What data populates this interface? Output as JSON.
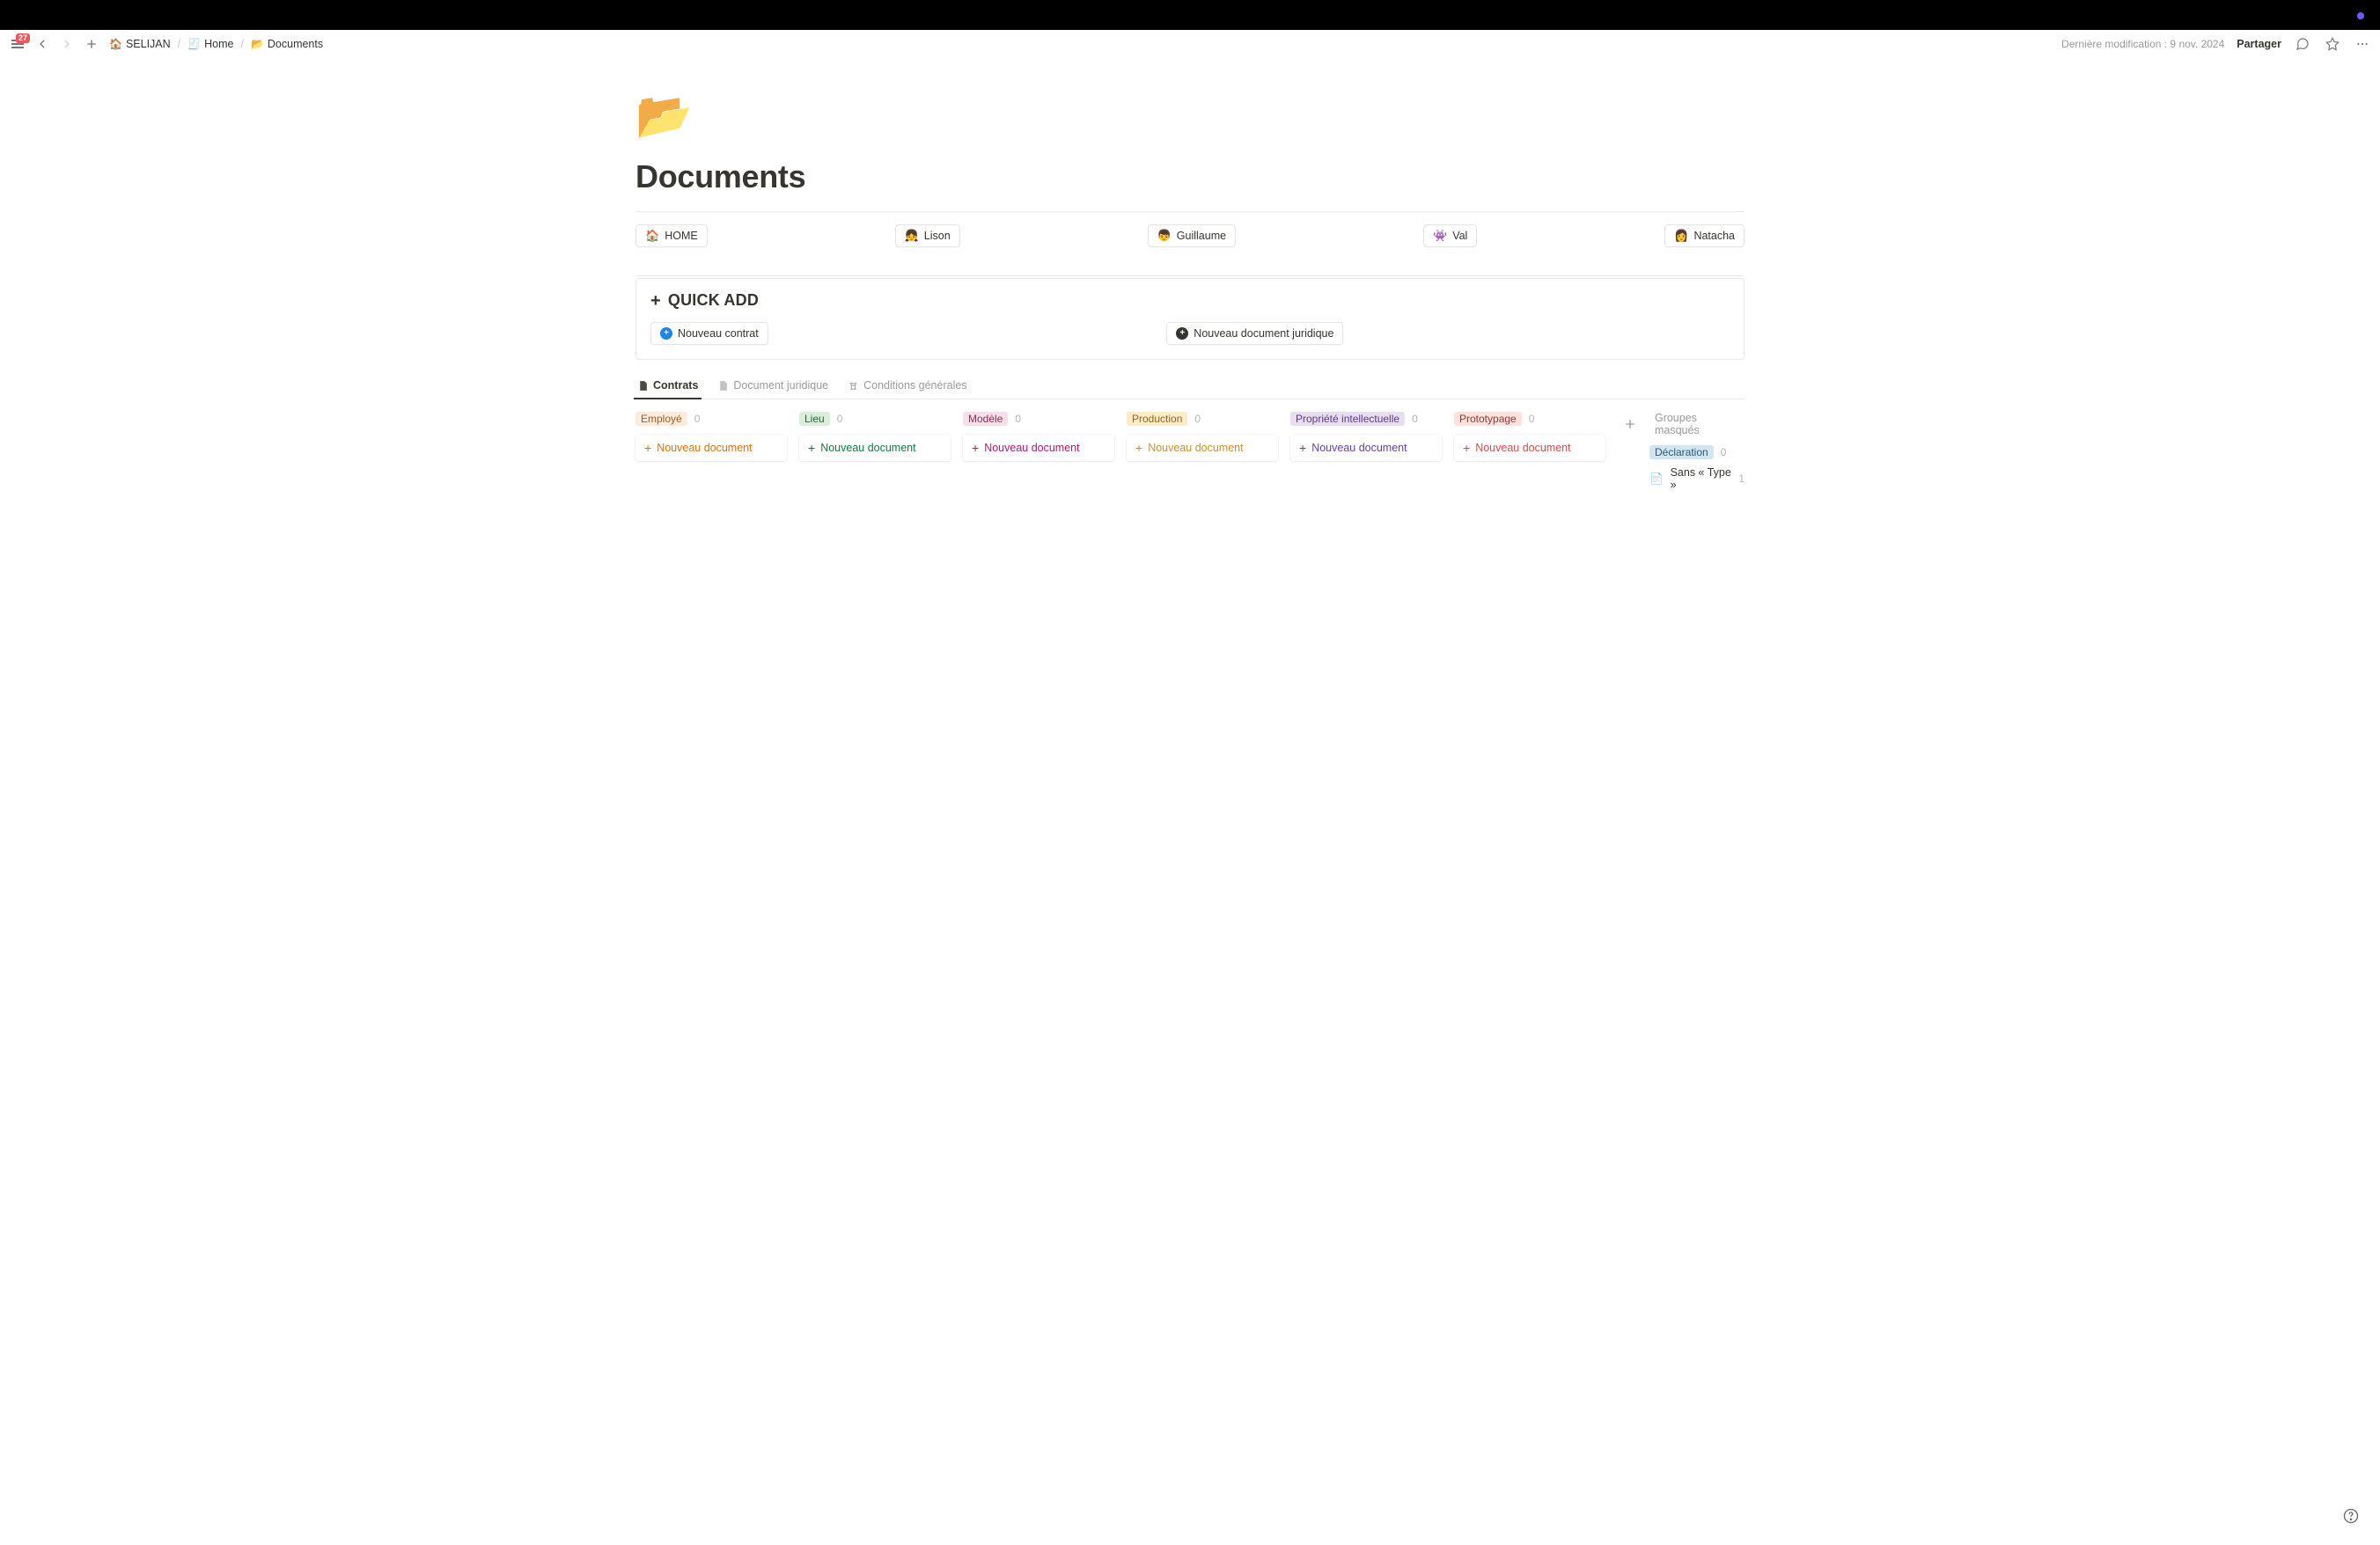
{
  "topbar": {
    "badge_count": "27",
    "breadcrumb": [
      {
        "icon": "🏠",
        "label": "SELIJAN"
      },
      {
        "icon": "🧾",
        "label": "Home"
      },
      {
        "icon": "📂",
        "label": "Documents"
      }
    ],
    "last_modified": "Dernière modification : 9 nov. 2024",
    "share_label": "Partager"
  },
  "page": {
    "icon": "📂",
    "title": "Documents"
  },
  "people": [
    {
      "icon": "🏠",
      "label": "HOME"
    },
    {
      "icon": "👧",
      "label": "Lison"
    },
    {
      "icon": "👦",
      "label": "Guillaume"
    },
    {
      "icon": "👾",
      "label": "Val"
    },
    {
      "icon": "👩",
      "label": "Natacha"
    }
  ],
  "quickadd": {
    "title": "QUICK ADD",
    "btn1": "Nouveau contrat",
    "btn2": "Nouveau document juridique"
  },
  "tabs": [
    {
      "label": "Contrats",
      "active": true
    },
    {
      "label": "Document juridique",
      "active": false
    },
    {
      "label": "Conditions générales",
      "active": false
    }
  ],
  "board": {
    "new_doc_label": "Nouveau document",
    "columns": [
      {
        "tag": "Employé",
        "count": 0,
        "bg": "#fdecdd",
        "fg": "#a05b1f",
        "plus": "#d9730d"
      },
      {
        "tag": "Lieu",
        "count": 0,
        "bg": "#dbeddb",
        "fg": "#1c6b3c",
        "plus": "#0f7b3f"
      },
      {
        "tag": "Modèle",
        "count": 0,
        "bg": "#f5e0e9",
        "fg": "#8a2e5b",
        "plus": "#ad1a72"
      },
      {
        "tag": "Production",
        "count": 0,
        "bg": "#fdecc8",
        "fg": "#8a6a1f",
        "plus": "#cb912f"
      },
      {
        "tag": "Propriété intellectuelle",
        "count": 0,
        "bg": "#e8deee",
        "fg": "#5b3a86",
        "plus": "#6940a5"
      },
      {
        "tag": "Prototypage",
        "count": 0,
        "bg": "#ffe2dd",
        "fg": "#8a3a34",
        "plus": "#d44c47"
      }
    ],
    "hidden_groups_label": "Groupes masqués",
    "hidden": [
      {
        "tag": "Déclaration",
        "count": 0,
        "bg": "#d3e5ef",
        "fg": "#2a5a7a"
      },
      {
        "icon": "📄",
        "label": "Sans « Type »",
        "count": 1
      }
    ]
  }
}
